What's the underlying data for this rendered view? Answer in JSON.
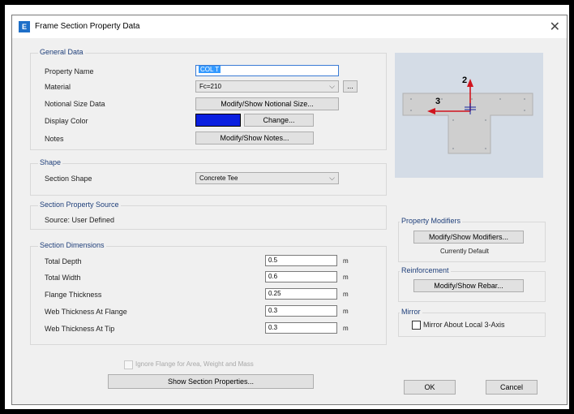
{
  "window": {
    "title": "Frame Section Property Data",
    "close_glyph": "✕"
  },
  "general_data": {
    "label": "General Data",
    "property_name_label": "Property Name",
    "property_name_value": "COL T",
    "material_label": "Material",
    "material_value": "Fc=210",
    "material_more": "...",
    "notional_size_label": "Notional Size Data",
    "notional_size_button": "Modify/Show Notional Size...",
    "display_color_label": "Display Color",
    "display_color_value": "#0a1fe0",
    "change_button": "Change...",
    "notes_label": "Notes",
    "notes_button": "Modify/Show Notes..."
  },
  "shape": {
    "label": "Shape",
    "section_shape_label": "Section Shape",
    "section_shape_value": "Concrete Tee"
  },
  "property_source": {
    "label": "Section Property Source",
    "source_text": "Source:  User Defined"
  },
  "dimensions": {
    "label": "Section Dimensions",
    "rows": [
      {
        "label": "Total Depth",
        "value": "0.5",
        "unit": "m"
      },
      {
        "label": "Total Width",
        "value": "0.6",
        "unit": "m"
      },
      {
        "label": "Flange Thickness",
        "value": "0.25",
        "unit": "m"
      },
      {
        "label": "Web Thickness At Flange",
        "value": "0.3",
        "unit": "m"
      },
      {
        "label": "Web Thickness At Tip",
        "value": "0.3",
        "unit": "m"
      }
    ],
    "ignore_flange_label": "Ignore Flange for Area, Weight and Mass",
    "show_props_button": "Show Section Properties..."
  },
  "preview": {
    "axis2_label": "2",
    "axis3_label": "3"
  },
  "property_modifiers": {
    "label": "Property Modifiers",
    "button": "Modify/Show Modifiers...",
    "status": "Currently Default"
  },
  "reinforcement": {
    "label": "Reinforcement",
    "button": "Modify/Show Rebar..."
  },
  "mirror": {
    "label": "Mirror",
    "checkbox_label": "Mirror About Local 3-Axis"
  },
  "footer": {
    "ok": "OK",
    "cancel": "Cancel"
  },
  "colors": {
    "title_icon": "#1e6fc8",
    "group_label": "#1f3f7a",
    "axis_arrow": "#d0141e",
    "display_color": "#0a1fe0"
  }
}
